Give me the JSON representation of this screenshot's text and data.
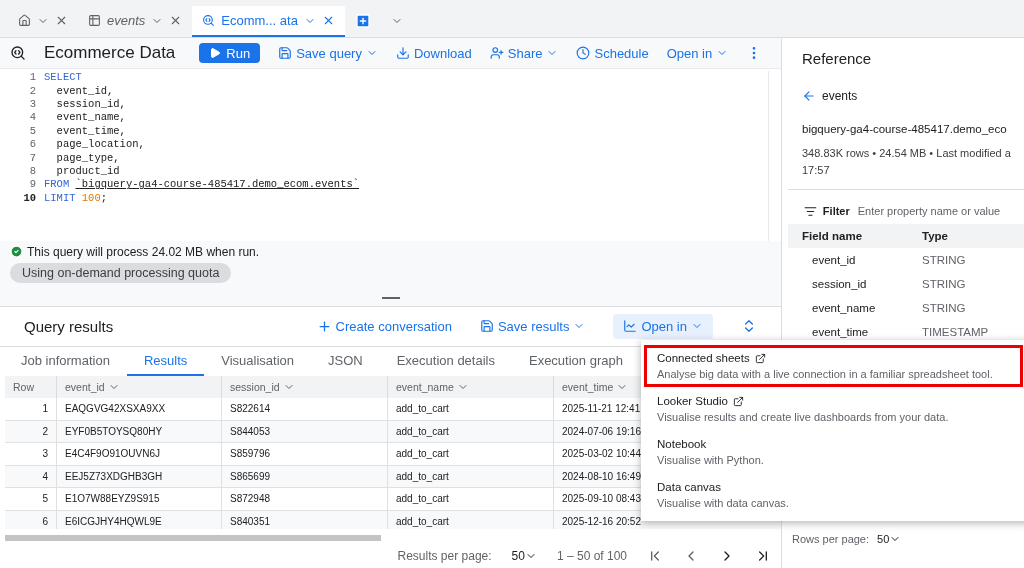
{
  "tabs": [
    {
      "kind": "home",
      "selected": false
    },
    {
      "kind": "table",
      "label": "events",
      "selected": false
    },
    {
      "kind": "query",
      "label": "Ecomm... ata",
      "selected": true
    }
  ],
  "toolbar": {
    "title": "Ecommerce Data",
    "run": "Run",
    "actions": [
      {
        "kind": "save",
        "label": "Save query",
        "menu": true
      },
      {
        "kind": "download",
        "label": "Download",
        "menu": false
      },
      {
        "kind": "share",
        "label": "Share",
        "menu": true
      },
      {
        "kind": "schedule",
        "label": "Schedule",
        "menu": false
      },
      {
        "kind": "none",
        "label": "Open in",
        "menu": true
      }
    ]
  },
  "editor": {
    "lines": [
      [
        {
          "kind": "keyword",
          "text": "SELECT"
        }
      ],
      [
        {
          "kind": "ident",
          "text": "  event_id,"
        }
      ],
      [
        {
          "kind": "ident",
          "text": "  session_id,"
        }
      ],
      [
        {
          "kind": "ident",
          "text": "  event_name,"
        }
      ],
      [
        {
          "kind": "ident",
          "text": "  event_time,"
        }
      ],
      [
        {
          "kind": "ident",
          "text": "  page_location,"
        }
      ],
      [
        {
          "kind": "ident",
          "text": "  page_type,"
        }
      ],
      [
        {
          "kind": "ident",
          "text": "  product_id"
        }
      ],
      [
        {
          "kind": "keyword",
          "text": "FROM "
        },
        {
          "kind": "table",
          "text": "`bigquery-ga4-course-485417.demo_ecom.events`"
        }
      ],
      [
        {
          "kind": "keyword",
          "text": "LIMIT "
        },
        {
          "kind": "number",
          "text": "100"
        },
        {
          "kind": "ident",
          "text": ";"
        }
      ]
    ],
    "line_numbers": [
      {
        "text": "1",
        "current": false
      },
      {
        "text": "2",
        "current": false
      },
      {
        "text": "3",
        "current": false
      },
      {
        "text": "4",
        "current": false
      },
      {
        "text": "5",
        "current": false
      },
      {
        "text": "6",
        "current": false
      },
      {
        "text": "7",
        "current": false
      },
      {
        "text": "8",
        "current": false
      },
      {
        "text": "9",
        "current": false
      },
      {
        "text": "10",
        "current": true
      }
    ]
  },
  "validation": "This query will process 24.02 MB when run.",
  "quota_chip": "Using on-demand processing quota",
  "results": {
    "title": "Query results",
    "actions": [
      {
        "kind": "plus",
        "label": "Create conversation",
        "menu": false,
        "selected": false
      },
      {
        "kind": "save",
        "label": "Save results",
        "menu": true,
        "selected": false
      },
      {
        "kind": "chart",
        "label": "Open in",
        "menu": true,
        "selected": true
      }
    ],
    "tabs": [
      {
        "label": "Job information",
        "selected": false
      },
      {
        "label": "Results",
        "selected": true
      },
      {
        "label": "Visualisation",
        "selected": false
      },
      {
        "label": "JSON",
        "selected": false
      },
      {
        "label": "Execution details",
        "selected": false
      },
      {
        "label": "Execution graph",
        "selected": false
      }
    ],
    "columns": [
      "Row",
      "event_id",
      "session_id",
      "event_name",
      "event_time"
    ],
    "rows": [
      [
        "1",
        "EAQGVG42XSXA9XX",
        "S822614",
        "add_to_cart",
        "2025-11-21 12:41"
      ],
      [
        "2",
        "EYF0B5TOYSQ80HY",
        "S844053",
        "add_to_cart",
        "2024-07-06 19:16"
      ],
      [
        "3",
        "E4C4F9O91OUVN6J",
        "S859796",
        "add_to_cart",
        "2025-03-02 10:44"
      ],
      [
        "4",
        "EEJ5Z73XDGHB3GH",
        "S865699",
        "add_to_cart",
        "2024-08-10 16:49"
      ],
      [
        "5",
        "E1O7W88EYZ9S915",
        "S872948",
        "add_to_cart",
        "2025-09-10 08:43"
      ],
      [
        "6",
        "E6ICGJHY4HQWL9E",
        "S840351",
        "add_to_cart",
        "2025-12-16 20:52"
      ]
    ],
    "footer": {
      "per_page_label": "Results per page:",
      "per_page": "50",
      "range": "1 – 50 of 100"
    }
  },
  "menu": {
    "items": [
      {
        "title": "Connected sheets",
        "description": "Analyse big data with a live connection in a familiar spreadsheet tool.",
        "external": true,
        "highlighted": true
      },
      {
        "title": "Looker Studio",
        "description": "Visualise results and create live dashboards from your data.",
        "external": true,
        "highlighted": false
      },
      {
        "title": "Notebook",
        "description": "Visualise with Python.",
        "external": false,
        "highlighted": false
      },
      {
        "title": "Data canvas",
        "description": "Visualise with data canvas.",
        "external": false,
        "highlighted": false
      }
    ]
  },
  "reference": {
    "title": "Reference",
    "back": "events",
    "path": "bigquery-ga4-course-485417.demo_eco",
    "meta": [
      "348.83K rows • 24.54 MB • Last modified a",
      "17:57"
    ],
    "filter_label": "Filter",
    "filter_placeholder": "Enter property name or value",
    "columns": [
      "Field name",
      "Type"
    ],
    "fields": [
      [
        "event_id",
        "STRING"
      ],
      [
        "session_id",
        "STRING"
      ],
      [
        "event_name",
        "STRING"
      ],
      [
        "event_time",
        "TIMESTAMP"
      ]
    ],
    "rows_per_page": "Rows per page:",
    "rows_value": "50"
  }
}
